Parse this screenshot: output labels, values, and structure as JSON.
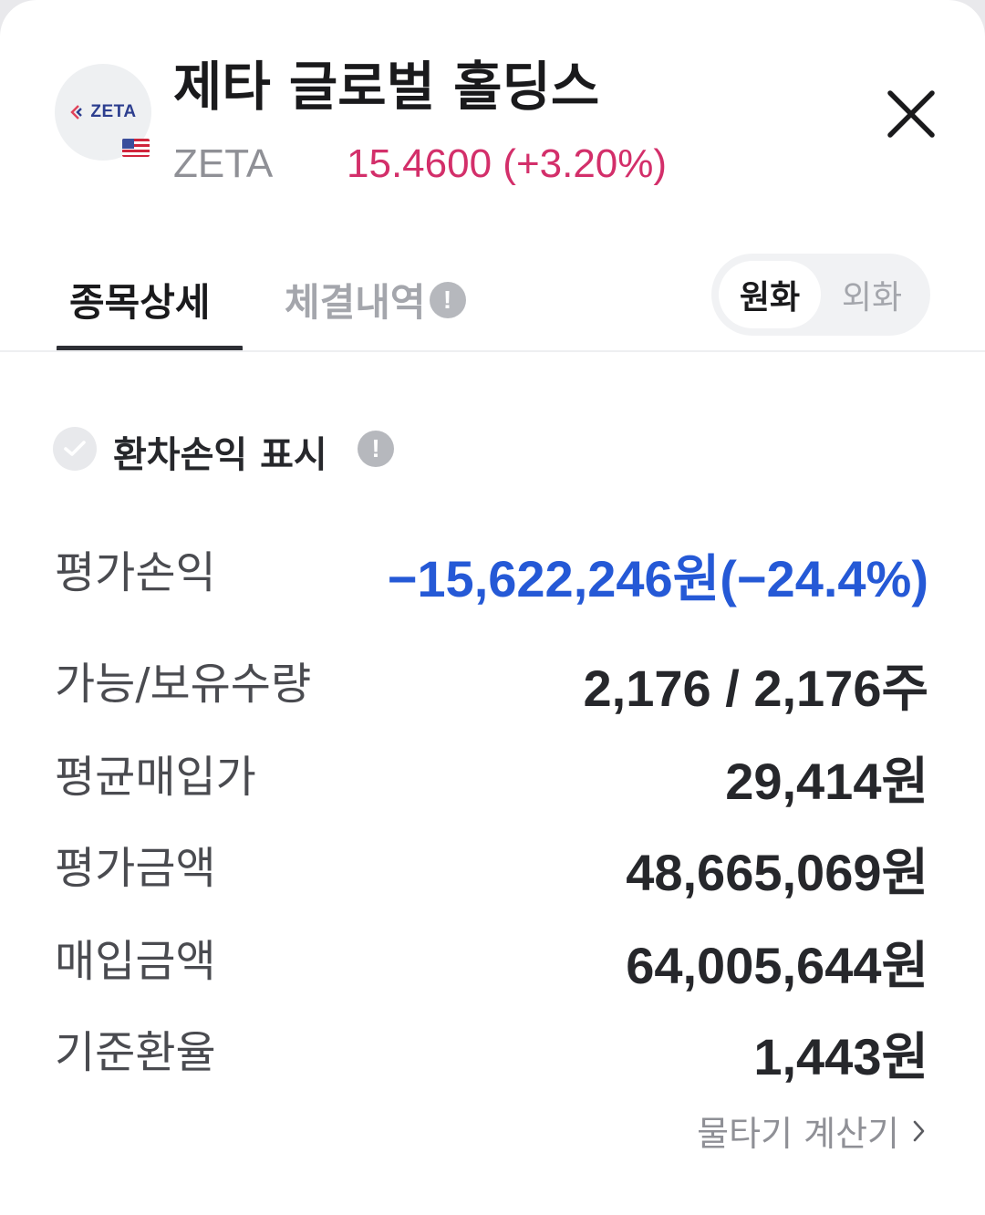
{
  "header": {
    "logo_text": "ZETA",
    "name": "제타 글로벌 홀딩스",
    "ticker": "ZETA",
    "price": "15.4600",
    "change": "(+3.20%)",
    "colors": {
      "up": "#d32f6a",
      "down": "#2559d6"
    }
  },
  "tabs": [
    {
      "label": "종목상세",
      "active": true
    },
    {
      "label": "체결내역",
      "active": false
    }
  ],
  "currency_toggle": {
    "options": [
      "원화",
      "외화"
    ],
    "selected": "원화"
  },
  "fx_option": {
    "label": "환차손익 표시",
    "checked": false
  },
  "rows": [
    {
      "label": "평가손익",
      "value": "−15,622,246원(−24.4%)"
    },
    {
      "label": "가능/보유수량",
      "value": "2,176 / 2,176주"
    },
    {
      "label": "평균매입가",
      "value": "29,414원"
    },
    {
      "label": "평가금액",
      "value": "48,665,069원"
    },
    {
      "label": "매입금액",
      "value": "64,005,644원"
    },
    {
      "label": "기준환율",
      "value": "1,443원"
    }
  ],
  "footer_link": {
    "label": "물타기 계산기"
  },
  "icons": {
    "close": "close-icon",
    "info": "info-icon",
    "check": "check-icon",
    "chevron": "chevron-right-icon",
    "flag": "us-flag-icon"
  }
}
